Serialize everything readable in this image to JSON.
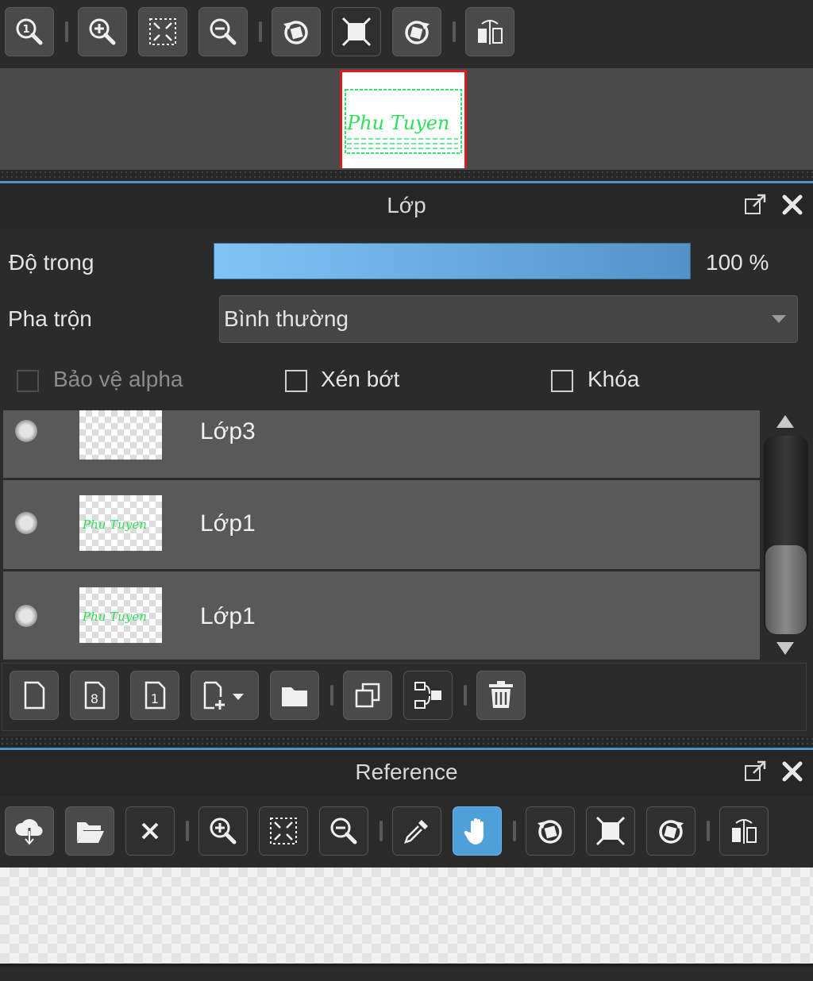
{
  "navigator": {
    "toolbar": [
      "zoom-actual-icon",
      "zoom-in-icon",
      "fit-screen-icon",
      "zoom-out-icon",
      "rotate-left-icon",
      "reset-view-icon",
      "rotate-right-icon",
      "flip-horizontal-icon"
    ],
    "preview_text": "Phu Tuyen"
  },
  "layer_panel": {
    "title": "Lớp",
    "opacity_label": "Độ trong",
    "opacity_value": "100 %",
    "opacity_fraction": 1.0,
    "blend_label": "Pha trộn",
    "blend_value": "Bình thường",
    "protect_alpha_label": "Bảo vệ alpha",
    "clipping_label": "Xén bớt",
    "lock_label": "Khóa",
    "layers": [
      {
        "name": "Lớp3",
        "thumb": "empty"
      },
      {
        "name": "Lớp1",
        "thumb": "text"
      },
      {
        "name": "Lớp1",
        "thumb": "text"
      }
    ],
    "thumb_text": "Phu Tuyen",
    "toolbar": [
      "new-layer-icon",
      "new-8bit-layer-icon",
      "new-1bit-layer-icon",
      "add-layer-dropdown-icon",
      "new-folder-icon",
      "duplicate-layer-icon",
      "merge-down-icon",
      "delete-layer-icon"
    ]
  },
  "reference_panel": {
    "title": "Reference",
    "toolbar": [
      "load-reference-icon",
      "open-folder-icon",
      "close-icon",
      "zoom-in-icon",
      "fit-screen-icon",
      "zoom-out-icon",
      "eyedropper-icon",
      "hand-tool-icon",
      "rotate-left-icon",
      "reset-view-icon",
      "rotate-right-icon",
      "flip-horizontal-icon"
    ]
  },
  "colors": {
    "accent": "#4a93c9",
    "selection_frame": "#e0191e",
    "active_tool": "#4f9fd8",
    "thumb_ink": "#2ee05a"
  }
}
